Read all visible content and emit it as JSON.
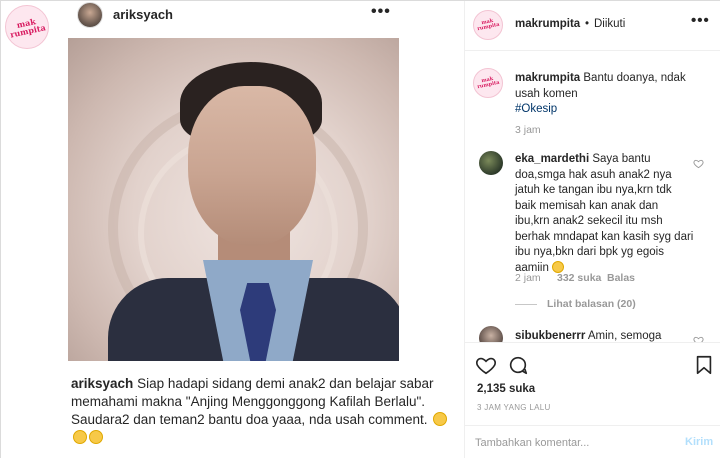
{
  "embedded_post": {
    "logo_text": "mak rumpita",
    "username": "ariksyach",
    "more_label": "•••",
    "caption_user": "ariksyach",
    "caption_text": "Siap hadapi sidang demi anak2 dan belajar sabar memahami makna \"Anjing Menggonggong Kafilah Berlalu\". Saudara2 dan teman2 bantu doa yaaa, nda usah comment."
  },
  "header": {
    "username": "makrumpita",
    "separator": "•",
    "follow_label": "Diikuti",
    "more_label": "•••"
  },
  "caption": {
    "username": "makrumpita",
    "text": "Bantu doanya, ndak usah komen",
    "hashtag": "#Okesip",
    "time": "3 jam"
  },
  "comments": [
    {
      "username": "eka_mardethi",
      "text": "Saya bantu doa,smga hak asuh anak2 nya jatuh ke tangan ibu nya,krn tdk baik memisah kan anak dan ibu,krn anak2 sekecil itu msh berhak mndapat kan kasih syg dari ibu nya,bkn dari bpk yg egois aamiin",
      "time": "2 jam",
      "likes": "332 suka",
      "reply_label": "Balas",
      "view_replies": "Lihat balasan (20)"
    },
    {
      "username": "sibukbenerrr",
      "text": "Amin, semoga"
    }
  ],
  "actions": {
    "likes": "2,135 suka",
    "time_ago": "3 JAM YANG LALU",
    "comment_placeholder": "Tambahkan komentar...",
    "send_label": "Kirim"
  },
  "icons": {
    "like": "heart-icon",
    "comment": "comment-icon",
    "save": "bookmark-icon",
    "more": "more-icon"
  }
}
